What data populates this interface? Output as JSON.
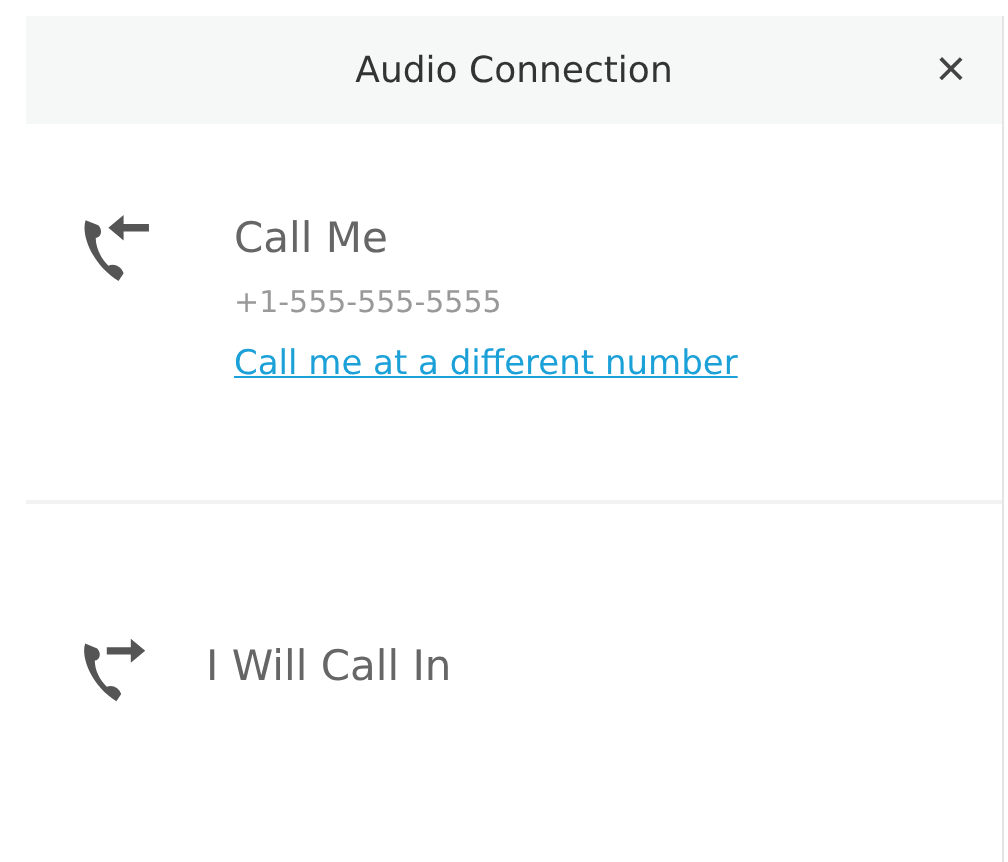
{
  "header": {
    "title": "Audio Connection",
    "close": "×"
  },
  "options": [
    {
      "kind": "call-me",
      "label": "Call Me",
      "number": "+1-555-555-5555",
      "link": "Call me at a different number"
    },
    {
      "kind": "call-in",
      "label": "I Will Call In"
    }
  ]
}
